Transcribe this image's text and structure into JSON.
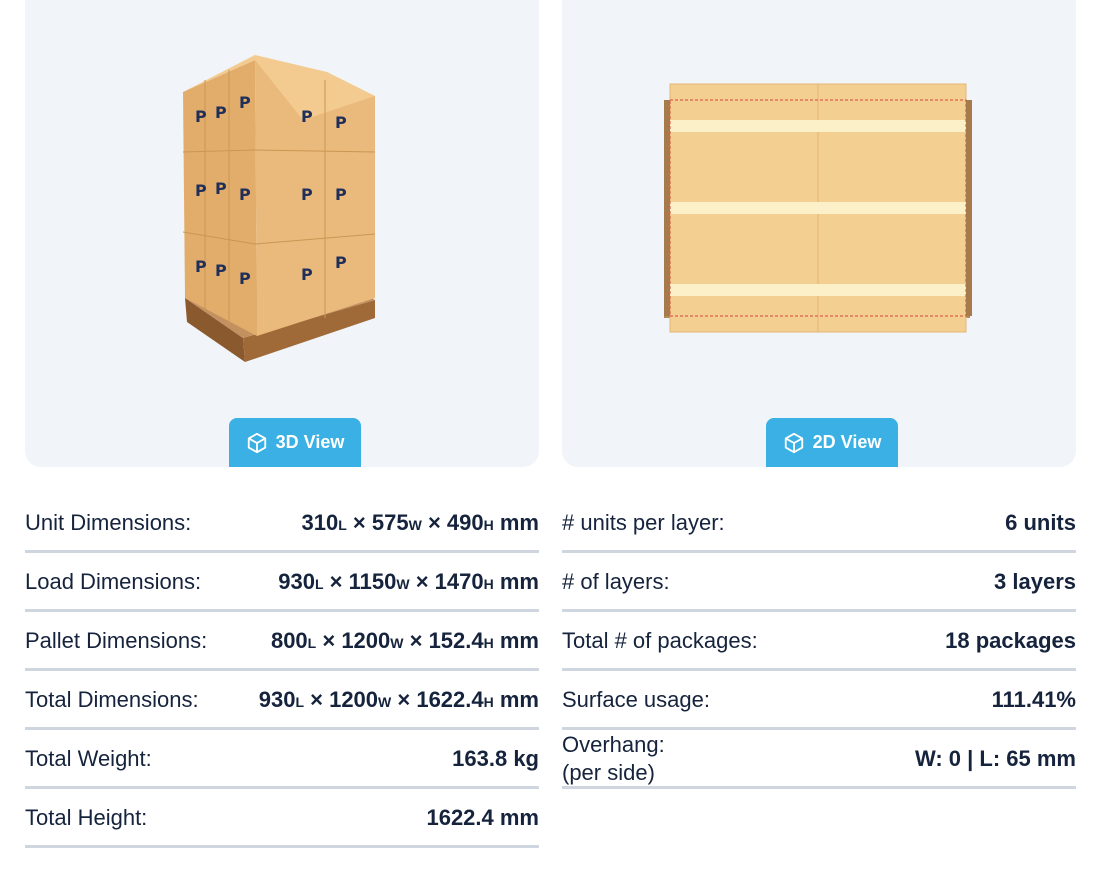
{
  "views": {
    "three_d_label": "3D View",
    "two_d_label": "2D View",
    "box_logo": "P"
  },
  "left": [
    {
      "label": "Unit Dimensions:",
      "l": "310",
      "w": "575",
      "h": "490",
      "unit": "mm"
    },
    {
      "label": "Load Dimensions:",
      "l": "930",
      "w": "1150",
      "h": "1470",
      "unit": "mm"
    },
    {
      "label": "Pallet Dimensions:",
      "l": "800",
      "w": "1200",
      "h": "152.4",
      "unit": "mm"
    },
    {
      "label": "Total Dimensions:",
      "l": "930",
      "w": "1200",
      "h": "1622.4",
      "unit": "mm"
    },
    {
      "label": "Total Weight:",
      "value": "163.8 kg"
    },
    {
      "label": "Total Height:",
      "value": "1622.4 mm"
    }
  ],
  "right": [
    {
      "label": "# units per layer:",
      "value": "6 units"
    },
    {
      "label": "# of layers:",
      "value": "3 layers"
    },
    {
      "label": "Total # of packages:",
      "value": "18 packages"
    },
    {
      "label": "Surface usage:",
      "value": "111.41%"
    },
    {
      "label_line1": "Overhang:",
      "label_line2": "(per side)",
      "value": "W: 0 | L: 65 mm"
    }
  ],
  "dim_suffix": {
    "l": "L",
    "w": "W",
    "h": "H",
    "times": "×"
  },
  "colors": {
    "accent": "#3ab0e4",
    "box": "#e8b97a",
    "pallet": "#b0804c",
    "text": "#15233c"
  }
}
